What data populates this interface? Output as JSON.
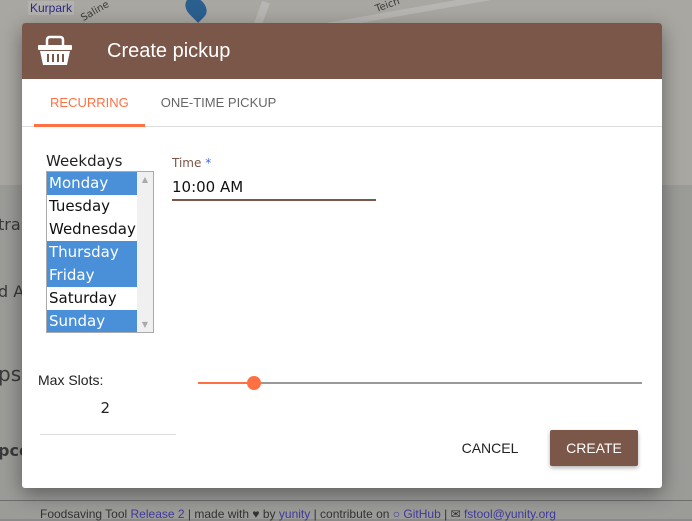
{
  "background": {
    "map_labels": [
      "Kurpark",
      "Saline",
      "Teich"
    ],
    "side_texts": [
      "traß",
      "d A",
      "ps",
      "pco"
    ]
  },
  "footer": {
    "app": "Foodsaving Tool",
    "release": "Release 2",
    "made_with": "| made with",
    "heart_icon": "heart-icon",
    "by": "by",
    "org": "yunity",
    "contribute": "| contribute on",
    "github": "GitHub",
    "sep": "|",
    "email": "fstool@yunity.org"
  },
  "dialog": {
    "title": "Create pickup",
    "icon": "basket-icon",
    "header_color": "#7b5749",
    "accent_color": "#ff7043",
    "tabs": [
      {
        "label": "RECURRING",
        "active": true
      },
      {
        "label": "ONE-TIME PICKUP",
        "active": false
      }
    ],
    "weekdays": {
      "label": "Weekdays",
      "options": [
        {
          "label": "Monday",
          "selected": true
        },
        {
          "label": "Tuesday",
          "selected": false
        },
        {
          "label": "Wednesday",
          "selected": false
        },
        {
          "label": "Thursday",
          "selected": true
        },
        {
          "label": "Friday",
          "selected": true
        },
        {
          "label": "Saturday",
          "selected": false
        },
        {
          "label": "Sunday",
          "selected": true
        }
      ]
    },
    "time": {
      "label": "Time",
      "required_mark": "*",
      "value": "10:00 AM"
    },
    "max_slots": {
      "label": "Max Slots:",
      "value": "2",
      "slider_fraction": 0.125
    },
    "cancel_label": "CANCEL",
    "create_label": "CREATE"
  }
}
